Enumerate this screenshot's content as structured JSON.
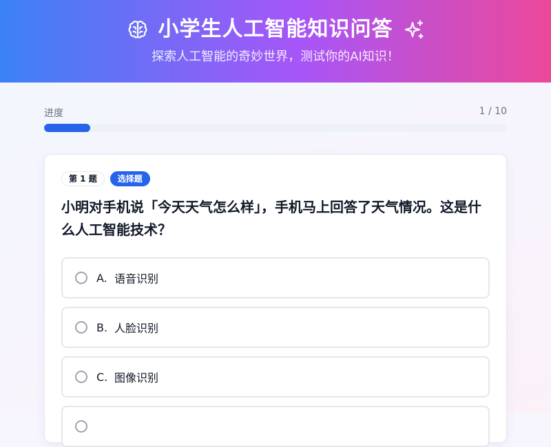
{
  "header": {
    "title": "小学生人工智能知识问答",
    "subtitle": "探索人工智能的奇妙世界，测试你的AI知识！",
    "left_icon": "brain-icon",
    "right_icon": "sparkles-icon"
  },
  "progress": {
    "label": "进度",
    "count_text": "1 / 10",
    "current": 1,
    "total": 10,
    "fill_fraction": 0.1
  },
  "question": {
    "number_badge": "第 1 题",
    "type_badge": "选择题",
    "text": "小明对手机说「今天天气怎么样」，手机马上回答了天气情况。这是什么人工智能技术？"
  },
  "options": [
    {
      "letter": "A.",
      "text": "语音识别"
    },
    {
      "letter": "B.",
      "text": "人脸识别"
    },
    {
      "letter": "C.",
      "text": "图像识别"
    },
    {
      "letter": "",
      "text": ""
    }
  ],
  "colors": {
    "accent": "#2563eb",
    "header_gradient_start": "#3b82f6",
    "header_gradient_mid": "#a855f7",
    "header_gradient_end": "#ec4899"
  }
}
